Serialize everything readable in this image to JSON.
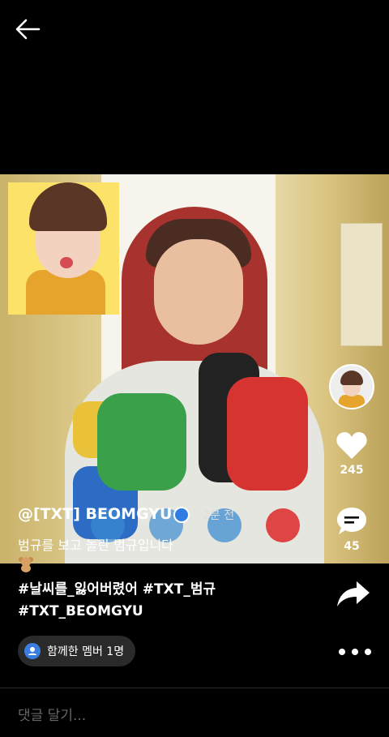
{
  "header": {
    "back_icon": "arrow-left-icon"
  },
  "video": {
    "pip_icon": "zepeto-avatar"
  },
  "sidebar": {
    "avatar_icon": "profile-avatar-icon",
    "like_icon": "heart-icon",
    "like_count": "245",
    "comment_icon": "comment-bubble-icon",
    "comment_count": "45",
    "share_icon": "share-arrow-icon"
  },
  "post": {
    "username": "@[TXT] BEOMGYU",
    "verified": true,
    "time": "· 2분 전",
    "caption": "범규를 보고 놀란 범규입니다",
    "emoji": "teddy-bear",
    "hashtags_line1": "#날씨를_잃어버렸어 #TXT_범규",
    "hashtags_line2": "#TXT_BEOMGYU"
  },
  "members": {
    "label": "함께한 멤버 1명",
    "icon": "person-icon"
  },
  "more_icon": "more-dots-icon",
  "comment_input": {
    "placeholder": "댓글 달기..."
  },
  "colors": {
    "background": "#000000",
    "verified": "#2f7de1",
    "members_pill": "#2a2a2a"
  }
}
